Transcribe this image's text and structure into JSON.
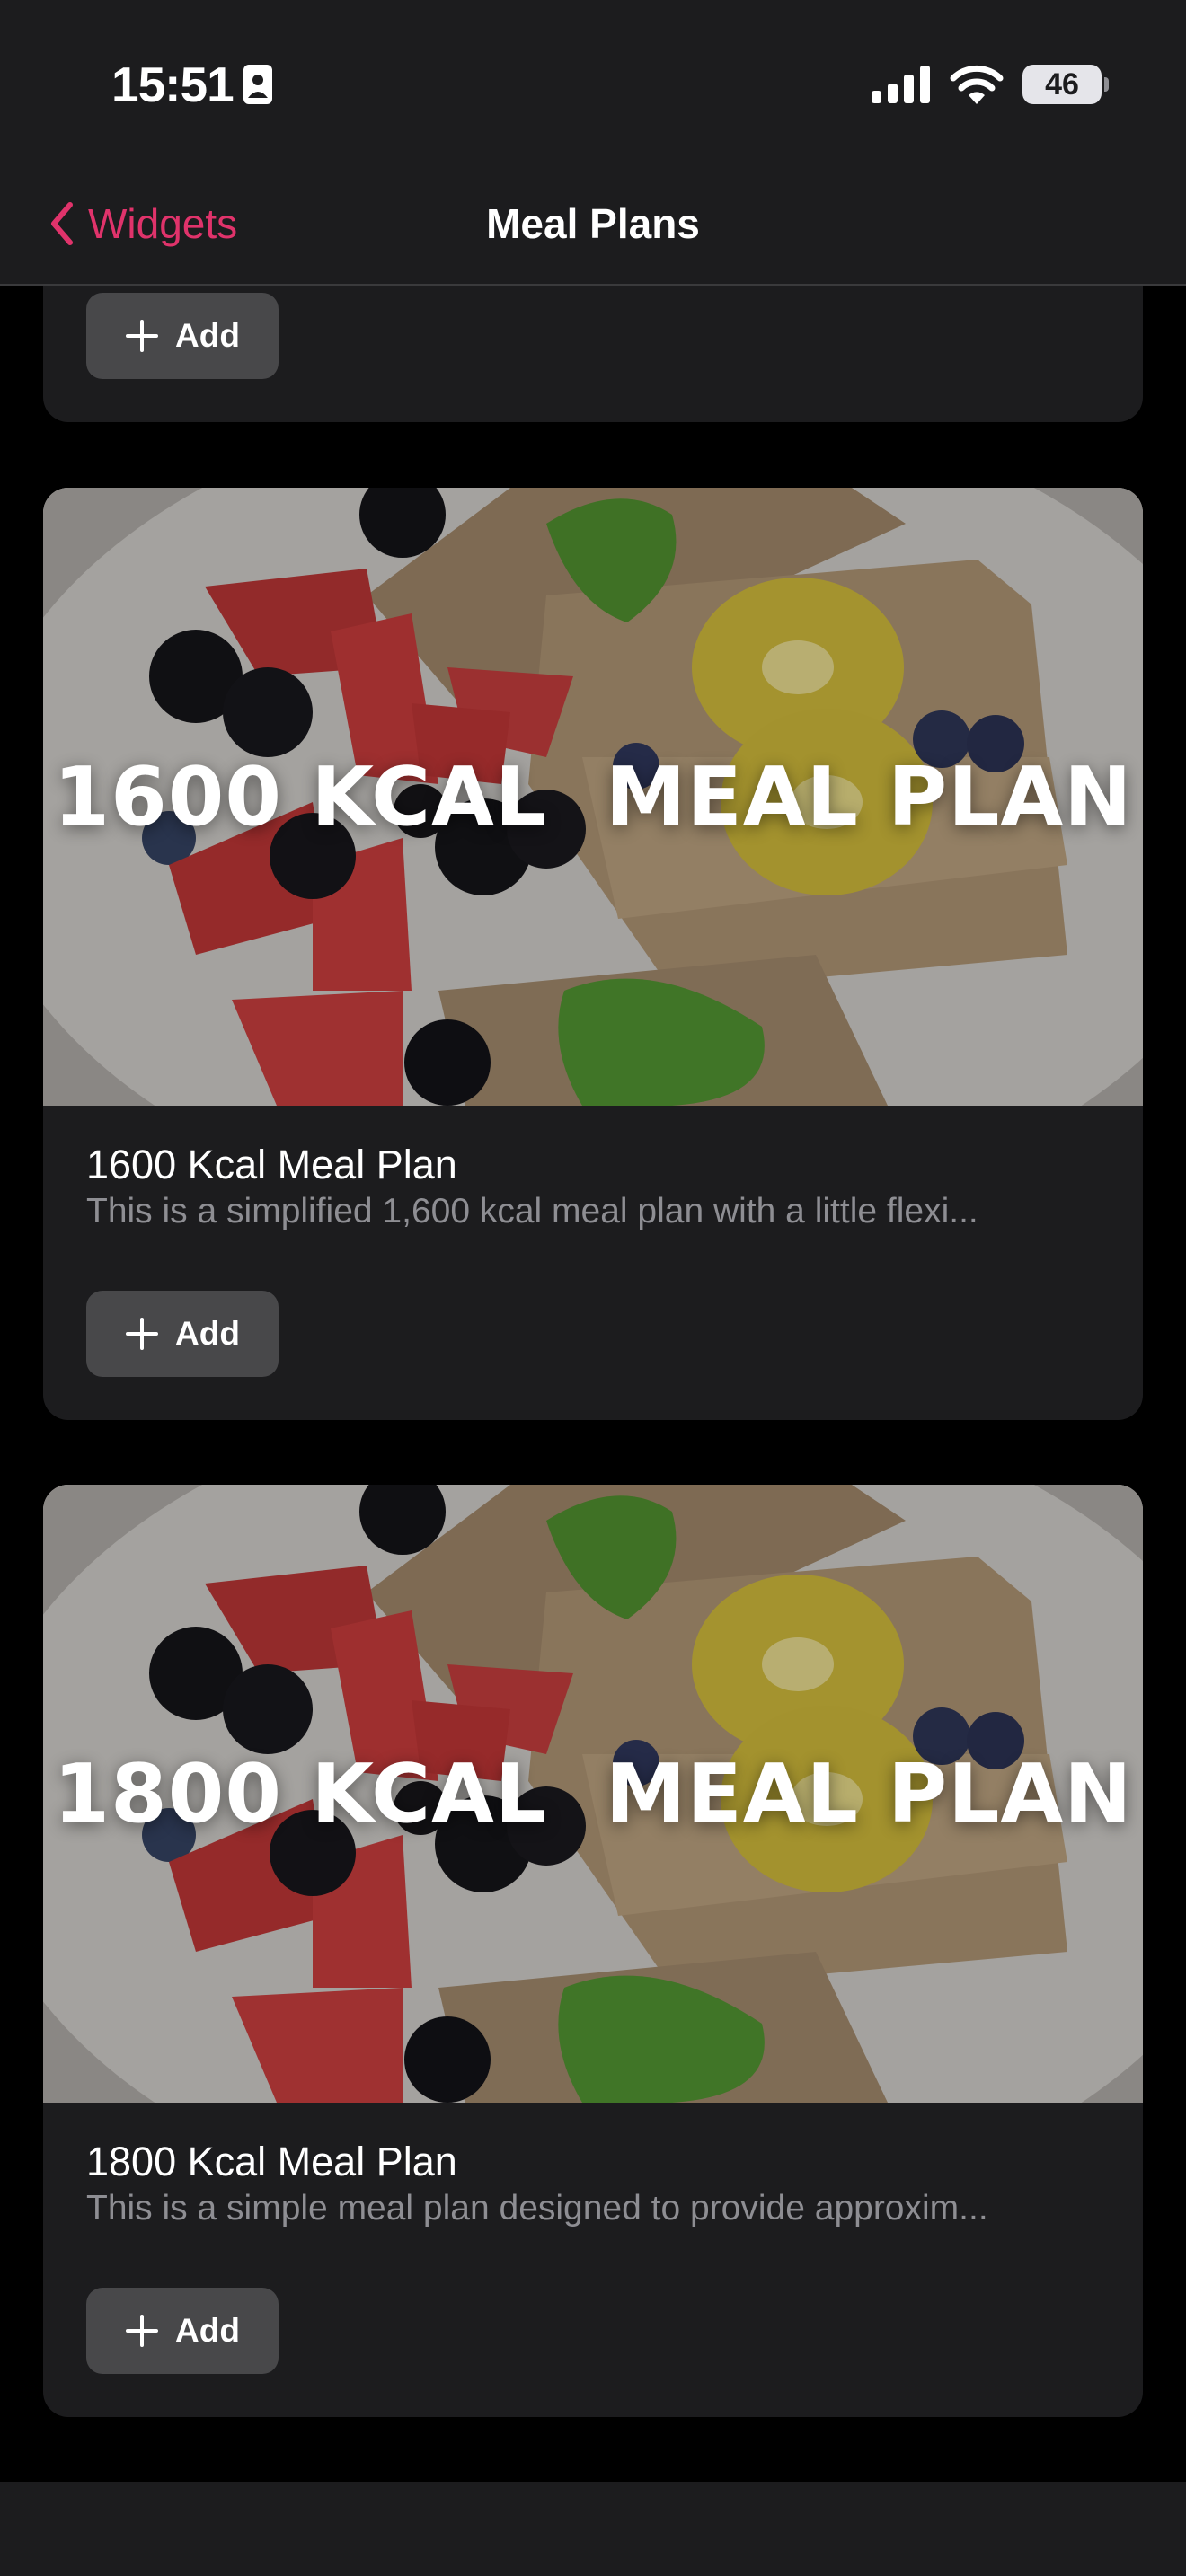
{
  "status_bar": {
    "time": "15:51",
    "battery_level": "46",
    "icons": [
      "id-card-icon",
      "cellular-signal-icon",
      "wifi-icon",
      "battery-icon"
    ]
  },
  "nav": {
    "back_label": "Widgets",
    "back_icon": "chevron-left-icon",
    "title": "Meal Plans"
  },
  "colors": {
    "accent": "#e0336b",
    "background": "#000000",
    "card": "#1c1c1e",
    "button": "#48484a",
    "secondary_text": "#8e8e93"
  },
  "partial_card": {
    "add_label": "Add"
  },
  "meal_plans": [
    {
      "banner": "1600 KCAL  MEAL PLAN",
      "title": "1600 Kcal Meal Plan",
      "description": "This is a simplified 1,600 kcal meal plan with a little flexi...",
      "add_label": "Add"
    },
    {
      "banner": "1800 KCAL  MEAL PLAN",
      "title": "1800 Kcal Meal Plan",
      "description": "This is a simple meal plan designed to provide approxim...",
      "add_label": "Add"
    }
  ]
}
